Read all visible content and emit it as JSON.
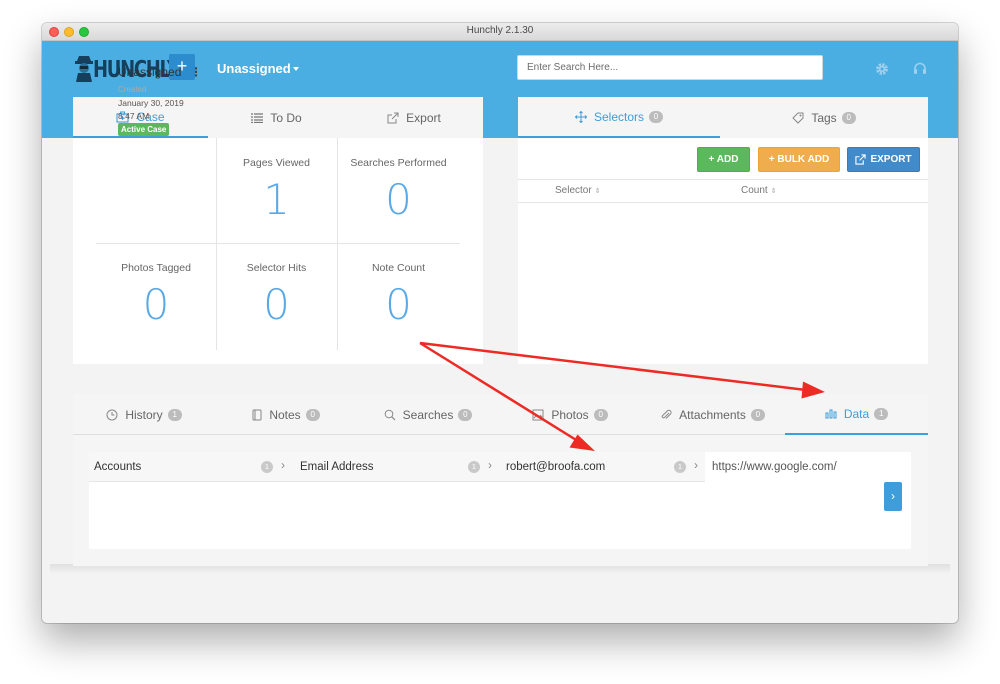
{
  "window": {
    "title": "Hunchly 2.1.30"
  },
  "header": {
    "logo_text": "HUNCHLY",
    "new_case_label": "+",
    "case_selector": "Unassigned",
    "search": {
      "placeholder": "Enter Search Here...",
      "value": ""
    },
    "icons": [
      "gear-icon",
      "headset-icon"
    ]
  },
  "left_panel": {
    "tabs": [
      {
        "label": "Case",
        "icon": "case-icon",
        "active": true
      },
      {
        "label": "To Do",
        "icon": "list-icon",
        "active": false
      },
      {
        "label": "Export",
        "icon": "export-icon",
        "active": false
      }
    ],
    "case": {
      "name": "Unassigned",
      "menu": "⋮",
      "created_label": "Created",
      "created_date": "January 30, 2019",
      "created_time": "8:47 AM",
      "status": "Active Case"
    },
    "stats": [
      {
        "label": "Pages Viewed",
        "value": "1"
      },
      {
        "label": "Searches Performed",
        "value": "0"
      },
      {
        "label": "Photos Tagged",
        "value": "0"
      },
      {
        "label": "Selector Hits",
        "value": "0"
      },
      {
        "label": "Note Count",
        "value": "0"
      }
    ]
  },
  "right_panel": {
    "tabs": [
      {
        "label": "Selectors",
        "count": "0",
        "icon": "move-icon",
        "active": true
      },
      {
        "label": "Tags",
        "count": "0",
        "icon": "tag-icon",
        "active": false
      }
    ],
    "buttons": {
      "add": "+ ADD",
      "bulk_add": "+ BULK ADD",
      "export": "EXPORT"
    },
    "columns": [
      "Selector",
      "Count"
    ]
  },
  "bottom_panel": {
    "tabs": [
      {
        "label": "History",
        "count": "1",
        "icon": "clock-icon"
      },
      {
        "label": "Notes",
        "count": "0",
        "icon": "note-icon"
      },
      {
        "label": "Searches",
        "count": "0",
        "icon": "search-icon"
      },
      {
        "label": "Photos",
        "count": "0",
        "icon": "photo-icon"
      },
      {
        "label": "Attachments",
        "count": "0",
        "icon": "paperclip-icon"
      },
      {
        "label": "Data",
        "count": "1",
        "icon": "bar-chart-icon",
        "active": true
      }
    ],
    "data_path": [
      {
        "label": "Accounts",
        "count": "1"
      },
      {
        "label": "Email Address",
        "count": "1"
      },
      {
        "label": "robert@broofa.com",
        "count": "1"
      }
    ],
    "url": "https://www.google.com/",
    "expand_label": "›"
  },
  "colors": {
    "header_blue": "#4aaee2",
    "accent_blue": "#3d9edb",
    "add_green": "#5cb85c",
    "bulk_orange": "#f0ad4e",
    "export_blue": "#428bca",
    "annotation_red": "#ee2a24"
  }
}
